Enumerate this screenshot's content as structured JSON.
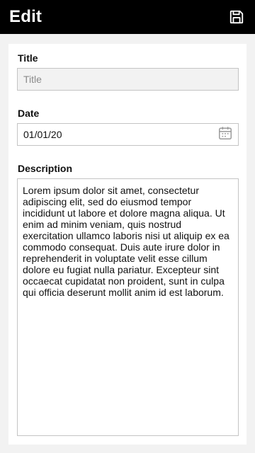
{
  "header": {
    "title": "Edit",
    "save_icon": "floppy-disk-icon"
  },
  "form": {
    "title": {
      "label": "Title",
      "placeholder": "Title",
      "value": ""
    },
    "date": {
      "label": "Date",
      "value": "01/01/20",
      "icon": "calendar-icon"
    },
    "description": {
      "label": "Description",
      "value": "Lorem ipsum dolor sit amet, consectetur adipiscing elit, sed do eiusmod tempor incididunt ut labore et dolore magna aliqua. Ut enim ad minim veniam, quis nostrud exercitation ullamco laboris nisi ut aliquip ex ea commodo consequat. Duis aute irure dolor in reprehenderit in voluptate velit esse cillum dolore eu fugiat nulla pariatur. Excepteur sint occaecat cupidatat non proident, sunt in culpa qui officia deserunt mollit anim id est laborum."
    }
  },
  "colors": {
    "appbar_bg": "#000000",
    "page_bg": "#f2f2f2",
    "card_bg": "#ffffff",
    "input_border": "#c4c4c4",
    "disabled_input_bg": "#f2f2f2"
  }
}
